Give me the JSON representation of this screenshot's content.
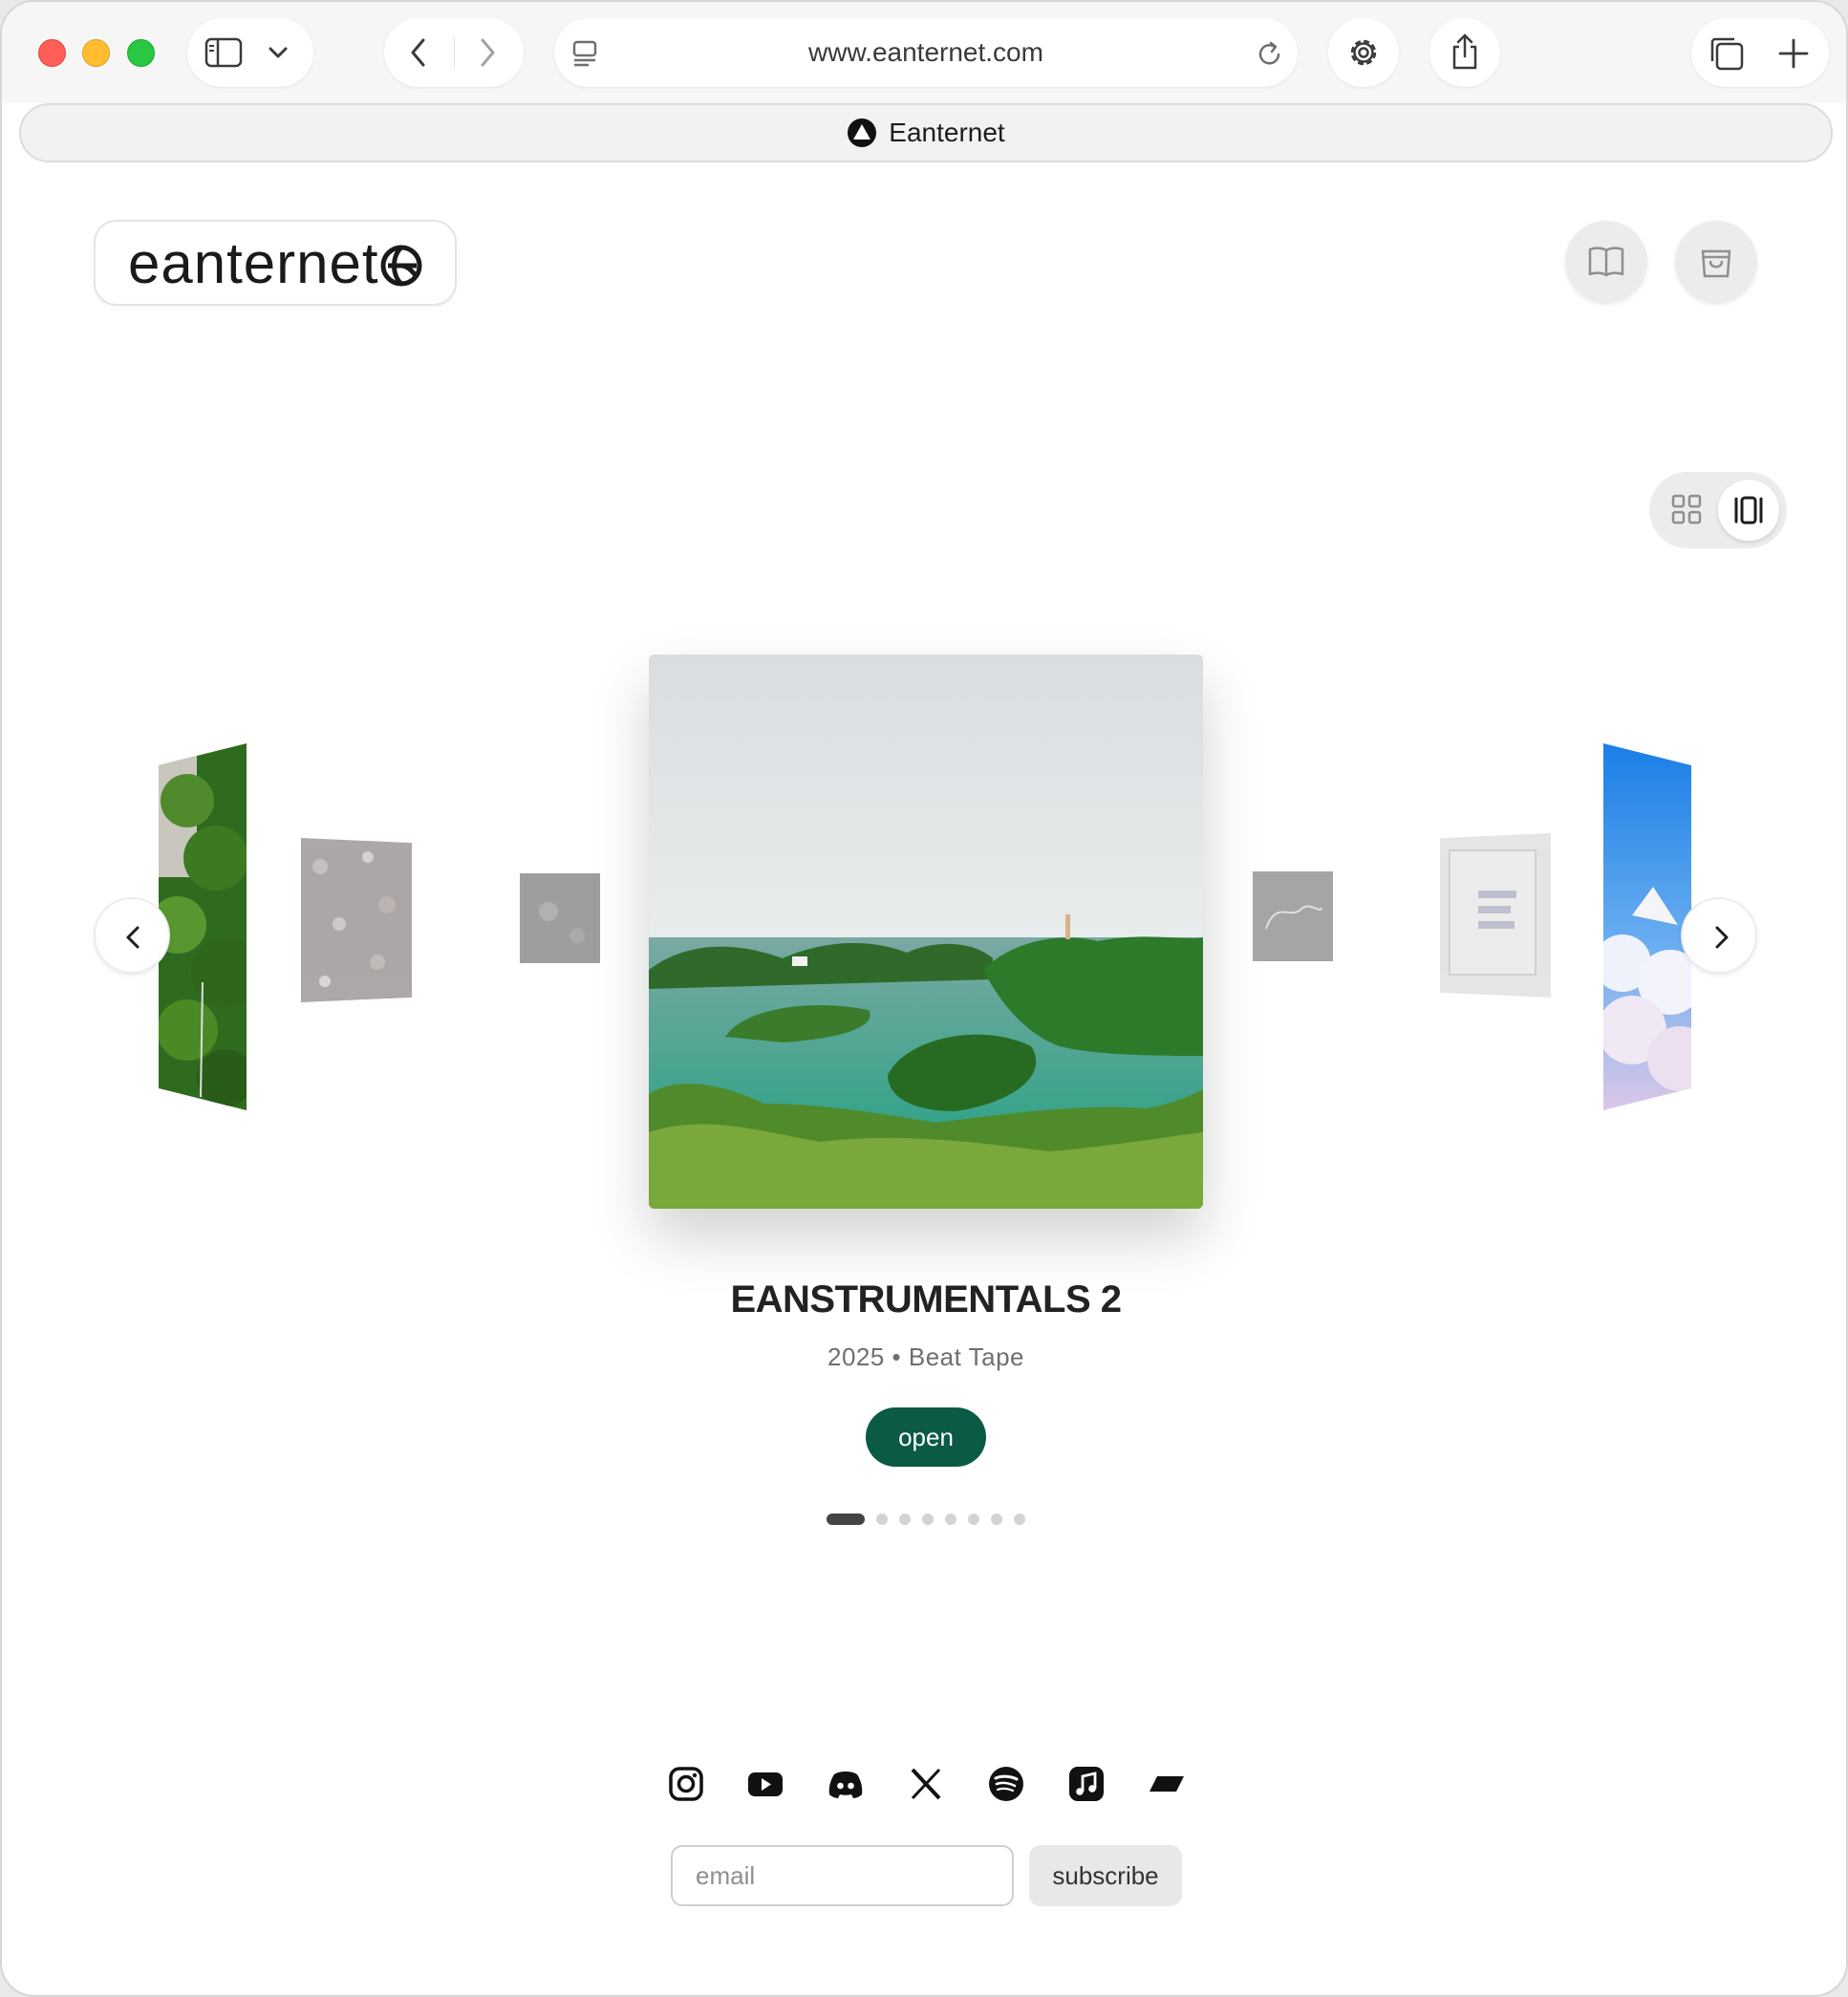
{
  "browser": {
    "url": "www.eanternet.com",
    "tab_title": "Eanternet"
  },
  "site": {
    "logo_text": "eanternet",
    "header_icons": [
      "book-open-icon",
      "shopping-bag-icon"
    ],
    "view_modes": [
      "grid-view-icon",
      "carousel-view-icon"
    ],
    "active_view": "carousel"
  },
  "carousel": {
    "title": "EANSTRUMENTALS 2",
    "meta": "2025 • Beat Tape",
    "open_label": "open",
    "slide_count": 8,
    "active_index": 0
  },
  "footer": {
    "social_icons": [
      "instagram-icon",
      "youtube-icon",
      "discord-icon",
      "x-icon",
      "spotify-icon",
      "apple-music-icon",
      "tidal-icon"
    ],
    "email_placeholder": "email",
    "subscribe_label": "subscribe"
  },
  "colors": {
    "accent": "#0a5a45",
    "page_bg": "#ffffff"
  }
}
